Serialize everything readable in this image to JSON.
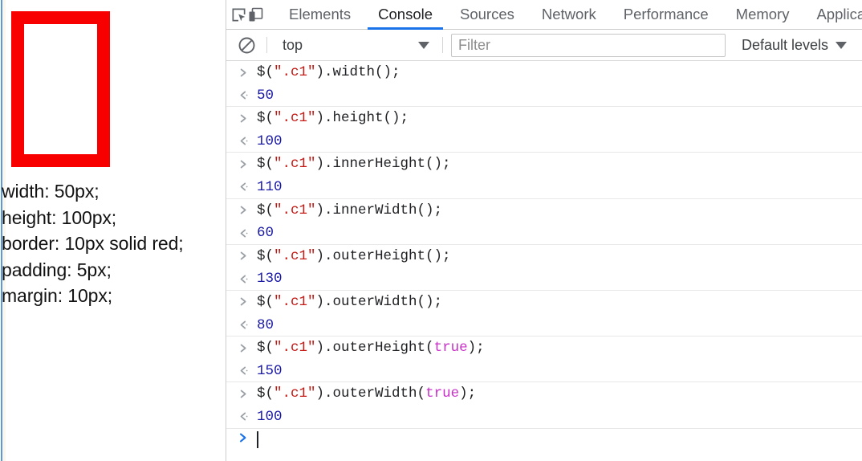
{
  "page": {
    "demo_box": {
      "name": "c1-demo-box",
      "border_color": "#f90000",
      "background": "#ffffff"
    },
    "css_rules": [
      "width: 50px;",
      "height: 100px;",
      "border: 10px solid red;",
      "padding: 5px;",
      "margin: 10px;"
    ]
  },
  "devtools": {
    "toolbar_icons": [
      {
        "name": "inspect-element-icon",
        "title": "Inspect"
      },
      {
        "name": "device-toolbar-icon",
        "title": "Toggle device toolbar"
      }
    ],
    "tabs": [
      {
        "label": "Elements",
        "active": false
      },
      {
        "label": "Console",
        "active": true
      },
      {
        "label": "Sources",
        "active": false
      },
      {
        "label": "Network",
        "active": false
      },
      {
        "label": "Performance",
        "active": false
      },
      {
        "label": "Memory",
        "active": false
      },
      {
        "label": "Applicat",
        "active": false
      }
    ],
    "active_tab": "Console",
    "accent_color": "#1a73e8",
    "filterbar": {
      "clear_icon": "clear-console-icon",
      "context": {
        "value": "top",
        "caret_icon": "chevron-down-icon"
      },
      "filter": {
        "value": "",
        "placeholder": "Filter"
      },
      "levels": {
        "label": "Default levels",
        "caret_icon": "chevron-down-icon"
      }
    },
    "console": {
      "input_marker": "input-caret-icon",
      "result_marker": "result-arrow-icon",
      "entries": [
        {
          "kind": "input",
          "parts": [
            {
              "t": "$(",
              "c": "plain"
            },
            {
              "t": "\".c1\"",
              "c": "str"
            },
            {
              "t": ").width();",
              "c": "plain"
            }
          ],
          "text": "$(\".c1\").width();"
        },
        {
          "kind": "result",
          "text": "50"
        },
        {
          "kind": "input",
          "parts": [
            {
              "t": "$(",
              "c": "plain"
            },
            {
              "t": "\".c1\"",
              "c": "str"
            },
            {
              "t": ").height();",
              "c": "plain"
            }
          ],
          "text": "$(\".c1\").height();"
        },
        {
          "kind": "result",
          "text": "100"
        },
        {
          "kind": "input",
          "parts": [
            {
              "t": "$(",
              "c": "plain"
            },
            {
              "t": "\".c1\"",
              "c": "str"
            },
            {
              "t": ").innerHeight();",
              "c": "plain"
            }
          ],
          "text": "$(\".c1\").innerHeight();"
        },
        {
          "kind": "result",
          "text": "110"
        },
        {
          "kind": "input",
          "parts": [
            {
              "t": "$(",
              "c": "plain"
            },
            {
              "t": "\".c1\"",
              "c": "str"
            },
            {
              "t": ").innerWidth();",
              "c": "plain"
            }
          ],
          "text": "$(\".c1\").innerWidth();"
        },
        {
          "kind": "result",
          "text": "60"
        },
        {
          "kind": "input",
          "parts": [
            {
              "t": "$(",
              "c": "plain"
            },
            {
              "t": "\".c1\"",
              "c": "str"
            },
            {
              "t": ").outerHeight();",
              "c": "plain"
            }
          ],
          "text": "$(\".c1\").outerHeight();"
        },
        {
          "kind": "result",
          "text": "130"
        },
        {
          "kind": "input",
          "parts": [
            {
              "t": "$(",
              "c": "plain"
            },
            {
              "t": "\".c1\"",
              "c": "str"
            },
            {
              "t": ").outerWidth();",
              "c": "plain"
            }
          ],
          "text": "$(\".c1\").outerWidth();"
        },
        {
          "kind": "result",
          "text": "80"
        },
        {
          "kind": "input",
          "parts": [
            {
              "t": "$(",
              "c": "plain"
            },
            {
              "t": "\".c1\"",
              "c": "str"
            },
            {
              "t": ").outerHeight(",
              "c": "plain"
            },
            {
              "t": "true",
              "c": "kw"
            },
            {
              "t": ");",
              "c": "plain"
            }
          ],
          "text": "$(\".c1\").outerHeight(true);"
        },
        {
          "kind": "result",
          "text": "150"
        },
        {
          "kind": "input",
          "parts": [
            {
              "t": "$(",
              "c": "plain"
            },
            {
              "t": "\".c1\"",
              "c": "str"
            },
            {
              "t": ").outerWidth(",
              "c": "plain"
            },
            {
              "t": "true",
              "c": "kw"
            },
            {
              "t": ");",
              "c": "plain"
            }
          ],
          "text": "$(\".c1\").outerWidth(true);"
        },
        {
          "kind": "result",
          "text": "100"
        }
      ],
      "prompt": {
        "marker": "prompt-caret-icon",
        "value": ""
      }
    }
  }
}
